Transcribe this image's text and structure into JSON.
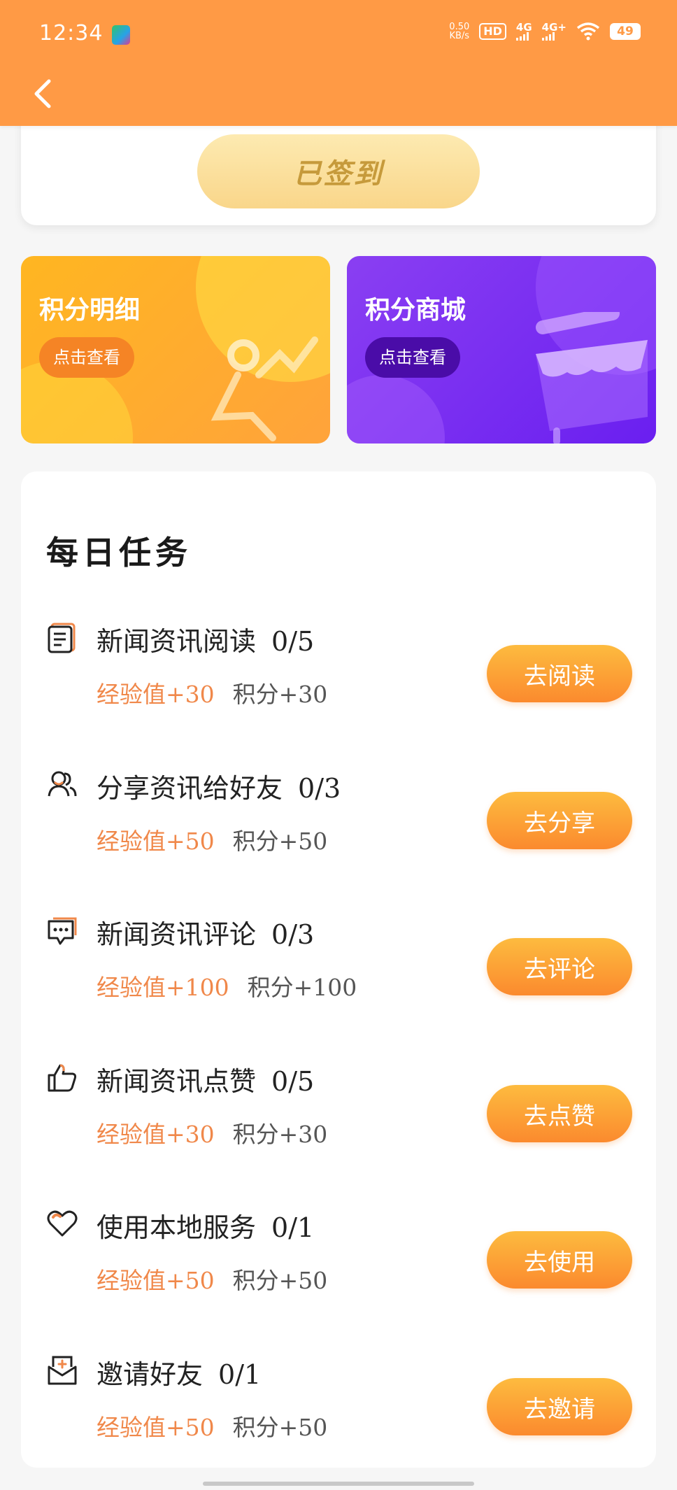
{
  "status_bar": {
    "time": "12:34",
    "net_speed_top": "0.50",
    "net_speed_bottom": "KB/s",
    "hd": "HD",
    "sig1": "4G",
    "sig2": "4G+",
    "battery": "49"
  },
  "signin": {
    "button_label": "已签到"
  },
  "promos": {
    "points": {
      "title": "积分明细",
      "action": "点击查看"
    },
    "mall": {
      "title": "积分商城",
      "action": "点击查看"
    }
  },
  "tasks": {
    "title": "每日任务",
    "items": [
      {
        "name": "新闻资讯阅读",
        "progress": "0/5",
        "exp": "经验值+30",
        "points": "积分+30",
        "button": "去阅读",
        "icon": "news-icon"
      },
      {
        "name": "分享资讯给好友",
        "progress": "0/3",
        "exp": "经验值+50",
        "points": "积分+50",
        "button": "去分享",
        "icon": "share-friends-icon"
      },
      {
        "name": "新闻资讯评论",
        "progress": "0/3",
        "exp": "经验值+100",
        "points": "积分+100",
        "button": "去评论",
        "icon": "comment-icon"
      },
      {
        "name": "新闻资讯点赞",
        "progress": "0/5",
        "exp": "经验值+30",
        "points": "积分+30",
        "button": "去点赞",
        "icon": "thumbs-up-icon"
      },
      {
        "name": "使用本地服务",
        "progress": "0/1",
        "exp": "经验值+50",
        "points": "积分+50",
        "button": "去使用",
        "icon": "heart-icon"
      },
      {
        "name": "邀请好友",
        "progress": "0/1",
        "exp": "经验值+50",
        "points": "积分+50",
        "button": "去邀请",
        "icon": "invite-mail-icon"
      }
    ]
  },
  "colors": {
    "header": "#ff9a45",
    "accent": "#fb8a2e",
    "exp": "#f0884a",
    "mall": "#7b2ff2"
  }
}
